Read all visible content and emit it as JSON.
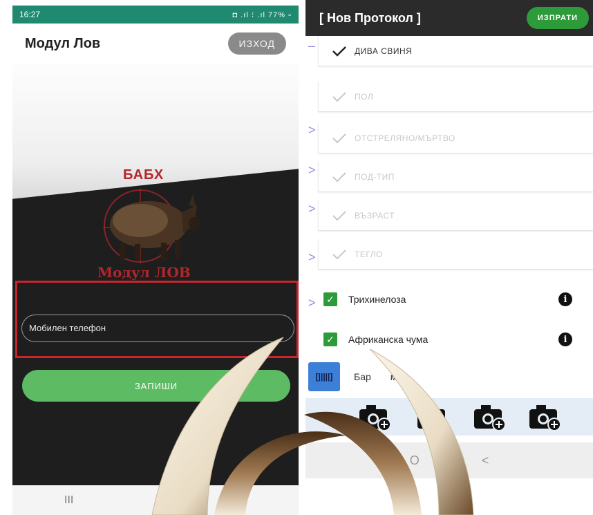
{
  "left": {
    "status_time": "16:27",
    "status_icons": "◘ .ıl ⁝ .ıl 77% ▫",
    "title": "Модул Лов",
    "exit_label": "ИЗХОД",
    "logo_top": "БАБХ",
    "logo_bottom": "Модул ЛОВ",
    "phone_placeholder": "Мобилен телефон",
    "save_label": "ЗАПИШИ",
    "nav_recent": "III"
  },
  "right": {
    "title": "[ Нов Протокол ]",
    "send_label": "ИЗПРАТИ",
    "rows": [
      {
        "label": "дива свиня"
      },
      {
        "label": "пол"
      },
      {
        "label": "отстреляно/мъртво"
      },
      {
        "label": "под-тип"
      },
      {
        "label": "възраст"
      },
      {
        "label": "тегло"
      }
    ],
    "checks": [
      {
        "label": "Трихинелоза",
        "checked": true
      },
      {
        "label": "Африканска чума",
        "checked": true
      }
    ],
    "barcode_label": "Бар  мер",
    "barcode_icon": "barcode-icon",
    "nav_home": "O",
    "nav_back": "<"
  },
  "colors": {
    "status_green": "#1f8a70",
    "brand_red": "#b3262b",
    "save_green": "#5dbb63",
    "send_green": "#2e9b3a",
    "barcode_blue": "#3d7fd6"
  }
}
